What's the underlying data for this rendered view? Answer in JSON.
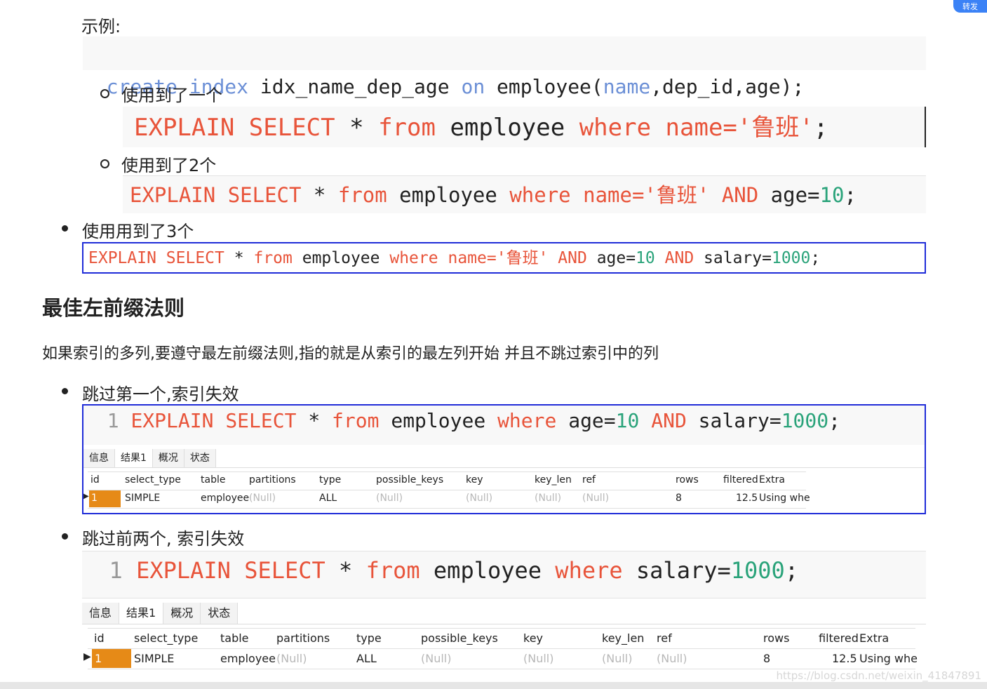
{
  "top_badge": "转发",
  "example_label": "示例:",
  "create_stmt": {
    "create": "create",
    "index": "index",
    "name": "idx_name_dep_age",
    "on": "on",
    "table": "employee(",
    "col1": "name",
    "rest": ",dep_id,age);"
  },
  "bullet1": "使用到了一个",
  "bullet2": "使用到了2个",
  "bullet3": "使用用到了3个",
  "sql1": {
    "explain": "EXPLAIN",
    "select": "SELECT",
    "star": "*",
    "from": "from",
    "table": "employee",
    "where": "where",
    "cond": "name=",
    "val": "'鲁班'",
    "end": ";"
  },
  "sql2": {
    "explain": "EXPLAIN",
    "select": "SELECT",
    "star": "*",
    "from": "from",
    "table": "employee",
    "where": "where",
    "cond": "name=",
    "val": "'鲁班'",
    "and": "AND",
    "cond2": "age=",
    "num": "10",
    "end": ";"
  },
  "sql3": {
    "explain": "EXPLAIN",
    "select": "SELECT",
    "star": "*",
    "from": "from",
    "table": "employee",
    "where": "where",
    "cond": "name=",
    "val": "'鲁班'",
    "and": "AND",
    "cond2": "age=",
    "num": "10",
    "and2": "AND",
    "cond3": "salary=",
    "num2": "1000",
    "end": ";"
  },
  "section_title": "最佳左前缀法则",
  "section_desc": "如果索引的多列,要遵守最左前缀法则,指的就是从索引的最左列开始 并且不跳过索引中的列",
  "bullet4": "跳过第一个,索引失效",
  "bullet5": "跳过前两个, 索引失效",
  "sql4": {
    "line": "1",
    "explain": "EXPLAIN",
    "select": "SELECT",
    "star": "*",
    "from": "from",
    "table": "employee",
    "where": "where",
    "cond": "age=",
    "num": "10",
    "and": "AND",
    "cond2": "salary=",
    "num2": "1000",
    "end": ";"
  },
  "sql5": {
    "line": "1",
    "explain": "EXPLAIN",
    "select": "SELECT",
    "star": "*",
    "from": "from",
    "table": "employee",
    "where": "where",
    "cond": "salary=",
    "num": "1000",
    "end": ";"
  },
  "tabs": [
    "信息",
    "结果1",
    "概况",
    "状态"
  ],
  "result_headers": [
    "id",
    "select_type",
    "table",
    "partitions",
    "type",
    "possible_keys",
    "key",
    "key_len",
    "ref",
    "rows",
    "filtered",
    "Extra"
  ],
  "result_row": [
    "1",
    "SIMPLE",
    "employee",
    "(Null)",
    "ALL",
    "(Null)",
    "(Null)",
    "(Null)",
    "(Null)",
    "8",
    "12.5",
    "Using whe"
  ],
  "watermark": "https://blog.csdn.net/weixin_41847891"
}
